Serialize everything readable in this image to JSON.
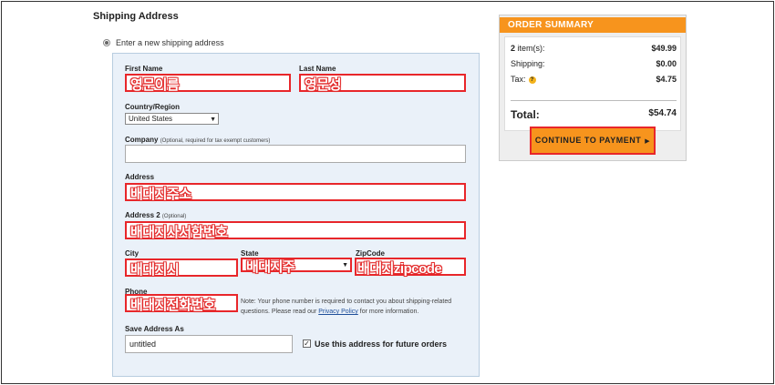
{
  "form": {
    "title": "Shipping Address",
    "radio_label": "Enter a new shipping address",
    "first_name_label": "First Name",
    "first_name_value": "영문이름",
    "last_name_label": "Last Name",
    "last_name_value": "영문성",
    "country_label": "Country/Region",
    "country_value": "United States",
    "company_label": "Company",
    "company_sub": "(Optional, required for tax exempt customers)",
    "address_label": "Address",
    "address_value": "배대지주소",
    "address2_label": "Address 2",
    "address2_sub": "(Optional)",
    "address2_value": "배대지사서함번호",
    "city_label": "City",
    "city_value": "배대지시",
    "state_label": "State",
    "state_value": "배대지주",
    "zip_label": "ZipCode",
    "zip_value": "배대지zipcode",
    "phone_label": "Phone",
    "phone_value": "배대지전화번호",
    "phone_note_1": "Note: Your phone number is required to contact you about shipping-related questions. Please read our ",
    "phone_note_link": "Privacy Policy",
    "phone_note_2": " for more information.",
    "save_as_label": "Save Address As",
    "save_as_value": "untitled",
    "future_use_label": "Use this address for future orders",
    "future_use_checked": "✓"
  },
  "summary": {
    "title": "ORDER SUMMARY",
    "items_count": "2",
    "items_label": " item(s):",
    "items_amount": "$49.99",
    "shipping_label": "Shipping:",
    "shipping_amount": "$0.00",
    "tax_label": "Tax:",
    "tax_amount": "$4.75",
    "tax_help_icon": "?",
    "total_label": "Total:",
    "total_amount": "$54.74",
    "pay_button": "CONTINUE TO PAYMENT",
    "pay_arrow": "▶"
  },
  "colors": {
    "accent_orange": "#f7941d",
    "highlight_red": "#e8262a",
    "panel_blue": "#eaf1f9"
  }
}
